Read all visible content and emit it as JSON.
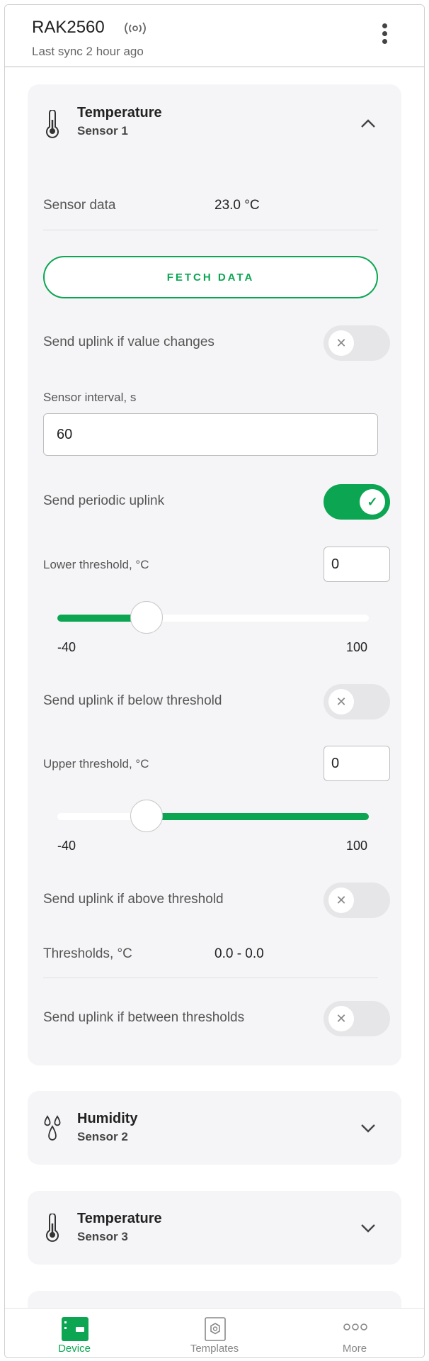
{
  "header": {
    "device_name": "RAK2560",
    "last_sync": "Last sync 2 hour ago"
  },
  "sensor1": {
    "title": "Temperature",
    "subtitle": "Sensor 1",
    "sensor_data_label": "Sensor data",
    "sensor_data_value": "23.0 °C",
    "fetch_button": "FETCH DATA",
    "uplink_on_change_label": "Send uplink if value changes",
    "uplink_on_change_enabled": false,
    "interval_label": "Sensor interval, s",
    "interval_value": "60",
    "periodic_label": "Send periodic uplink",
    "periodic_enabled": true,
    "lower_label": "Lower threshold, °C",
    "lower_value": "0",
    "lower_slider": {
      "min": "-40",
      "max": "100",
      "value": 0
    },
    "below_label": "Send uplink if below threshold",
    "below_enabled": false,
    "upper_label": "Upper threshold, °C",
    "upper_value": "0",
    "upper_slider": {
      "min": "-40",
      "max": "100",
      "value": 0
    },
    "above_label": "Send uplink if above threshold",
    "above_enabled": false,
    "thresholds_label": "Thresholds, °C",
    "thresholds_value": "0.0 - 0.0",
    "between_label": "Send uplink if between thresholds",
    "between_enabled": false
  },
  "sensor2": {
    "title": "Humidity",
    "subtitle": "Sensor 2"
  },
  "sensor3": {
    "title": "Temperature",
    "subtitle": "Sensor 3"
  },
  "tabs": [
    {
      "label": "Device",
      "icon": "device-icon",
      "active": true
    },
    {
      "label": "Templates",
      "icon": "templates-icon",
      "active": false
    },
    {
      "label": "More",
      "icon": "more-dots-icon",
      "active": false
    }
  ],
  "colors": {
    "accent": "#0ca653",
    "card_bg": "#f5f5f7"
  }
}
